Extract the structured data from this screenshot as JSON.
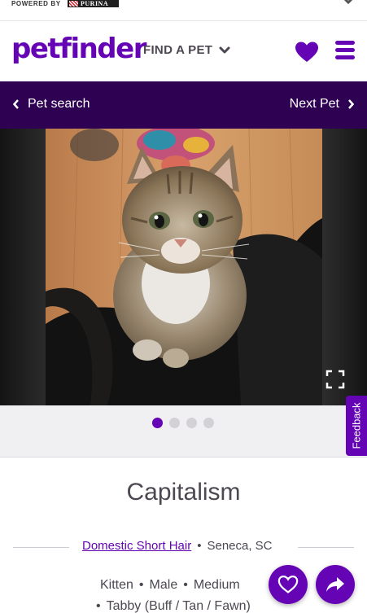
{
  "banner": {
    "powered_by": "POWERED BY",
    "brand": "PURINA"
  },
  "header": {
    "logo": "petfinder",
    "find_a_pet": "FIND A PET",
    "icons": {
      "favorites": "heart-icon",
      "menu": "hamburger-menu-icon",
      "find_caret": "chevron-down-icon"
    }
  },
  "navbar": {
    "prev_label": "Pet search",
    "next_label": "Next Pet"
  },
  "carousel": {
    "current_index": 1,
    "total": 4
  },
  "feedback": {
    "label": "Feedback"
  },
  "pet": {
    "name": "Capitalism",
    "breed": "Domestic Short Hair",
    "location": "Seneca, SC",
    "age": "Kitten",
    "sex": "Male",
    "size": "Medium",
    "coat": "Tabby (Buff / Tan / Fawn)"
  },
  "colors": {
    "brand": "#6504b5",
    "navbar_bg": "#2e0152",
    "text": "#4d4751"
  }
}
